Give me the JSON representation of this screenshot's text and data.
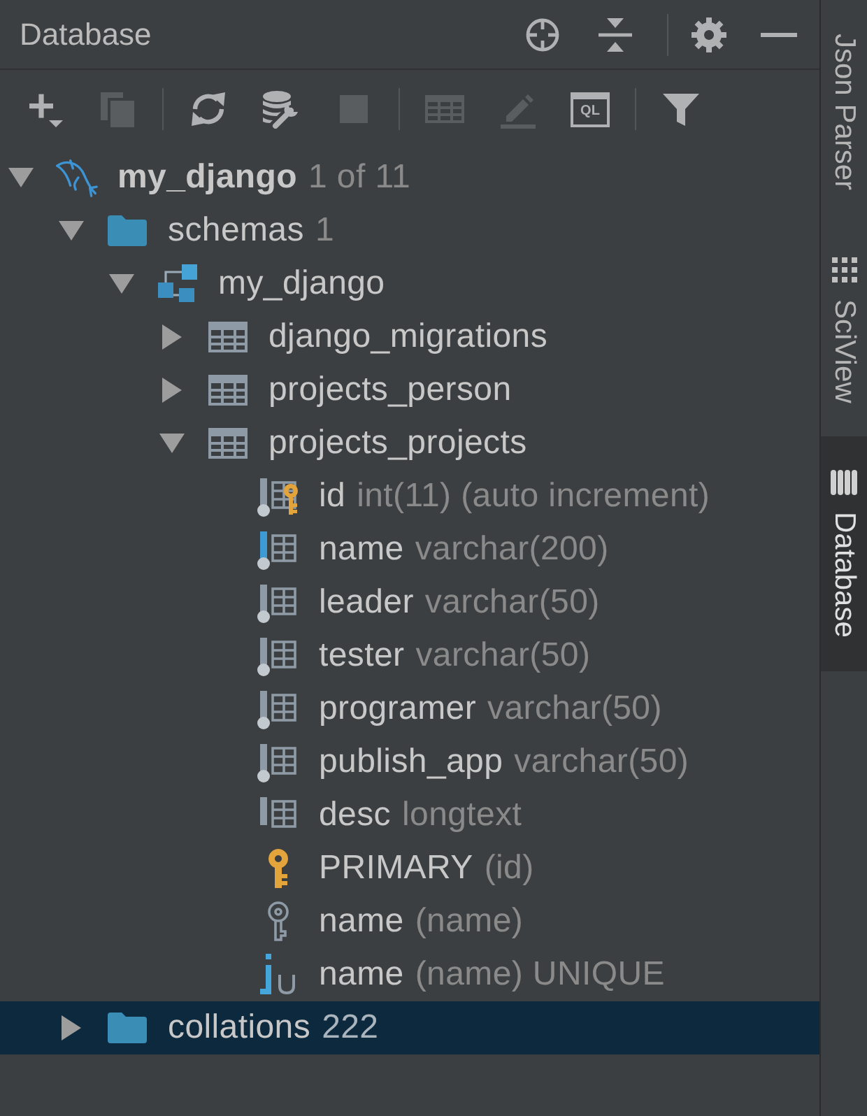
{
  "panel": {
    "title": "Database"
  },
  "toolbar": [
    {
      "kind": "add",
      "disabled": false
    },
    {
      "kind": "duplicate",
      "disabled": true
    },
    {
      "kind": "separator"
    },
    {
      "kind": "refresh",
      "disabled": false
    },
    {
      "kind": "properties",
      "disabled": false
    },
    {
      "kind": "stop",
      "disabled": true
    },
    {
      "kind": "separator"
    },
    {
      "kind": "table",
      "disabled": true
    },
    {
      "kind": "edit",
      "disabled": true
    },
    {
      "kind": "console",
      "label": "QL",
      "disabled": false
    },
    {
      "kind": "separator"
    },
    {
      "kind": "filter",
      "disabled": false
    }
  ],
  "tree": [
    {
      "kind": "datasource",
      "name": "my_django",
      "detail": "1 of 11",
      "expanded": true,
      "selected": false,
      "children": [
        {
          "kind": "folder",
          "name": "schemas",
          "detail": "1",
          "expanded": true,
          "selected": false,
          "children": [
            {
              "kind": "schema",
              "name": "my_django",
              "expanded": true,
              "selected": false,
              "children": [
                {
                  "kind": "table",
                  "name": "django_migrations",
                  "expanded": false,
                  "selected": false
                },
                {
                  "kind": "table",
                  "name": "projects_person",
                  "expanded": false,
                  "selected": false
                },
                {
                  "kind": "table",
                  "name": "projects_projects",
                  "expanded": true,
                  "selected": false,
                  "children": [
                    {
                      "kind": "column",
                      "name": "id",
                      "detail": "int(11) (auto increment)",
                      "not_null": true,
                      "primary_key": true,
                      "unique": false,
                      "selected": false
                    },
                    {
                      "kind": "column",
                      "name": "name",
                      "detail": "varchar(200)",
                      "not_null": true,
                      "primary_key": false,
                      "unique": true,
                      "selected": false
                    },
                    {
                      "kind": "column",
                      "name": "leader",
                      "detail": "varchar(50)",
                      "not_null": true,
                      "primary_key": false,
                      "unique": false,
                      "selected": false
                    },
                    {
                      "kind": "column",
                      "name": "tester",
                      "detail": "varchar(50)",
                      "not_null": true,
                      "primary_key": false,
                      "unique": false,
                      "selected": false
                    },
                    {
                      "kind": "column",
                      "name": "programer",
                      "detail": "varchar(50)",
                      "not_null": true,
                      "primary_key": false,
                      "unique": false,
                      "selected": false
                    },
                    {
                      "kind": "column",
                      "name": "publish_app",
                      "detail": "varchar(50)",
                      "not_null": true,
                      "primary_key": false,
                      "unique": false,
                      "selected": false
                    },
                    {
                      "kind": "column",
                      "name": "desc",
                      "detail": "longtext",
                      "not_null": false,
                      "primary_key": false,
                      "unique": false,
                      "selected": false
                    },
                    {
                      "kind": "primary_key",
                      "name": "PRIMARY",
                      "detail": "(id)",
                      "selected": false
                    },
                    {
                      "kind": "index",
                      "name": "name",
                      "detail": "(name)",
                      "selected": false
                    },
                    {
                      "kind": "unique_index",
                      "name": "name",
                      "detail": "(name) UNIQUE",
                      "selected": false
                    }
                  ]
                }
              ]
            }
          ]
        },
        {
          "kind": "folder",
          "name": "collations",
          "detail": "222",
          "expanded": false,
          "selected": true
        }
      ]
    }
  ],
  "side_tabs": [
    {
      "label": "Json Parser",
      "selected": false
    },
    {
      "label": "SciView",
      "selected": false
    },
    {
      "label": "Database",
      "selected": true
    }
  ]
}
